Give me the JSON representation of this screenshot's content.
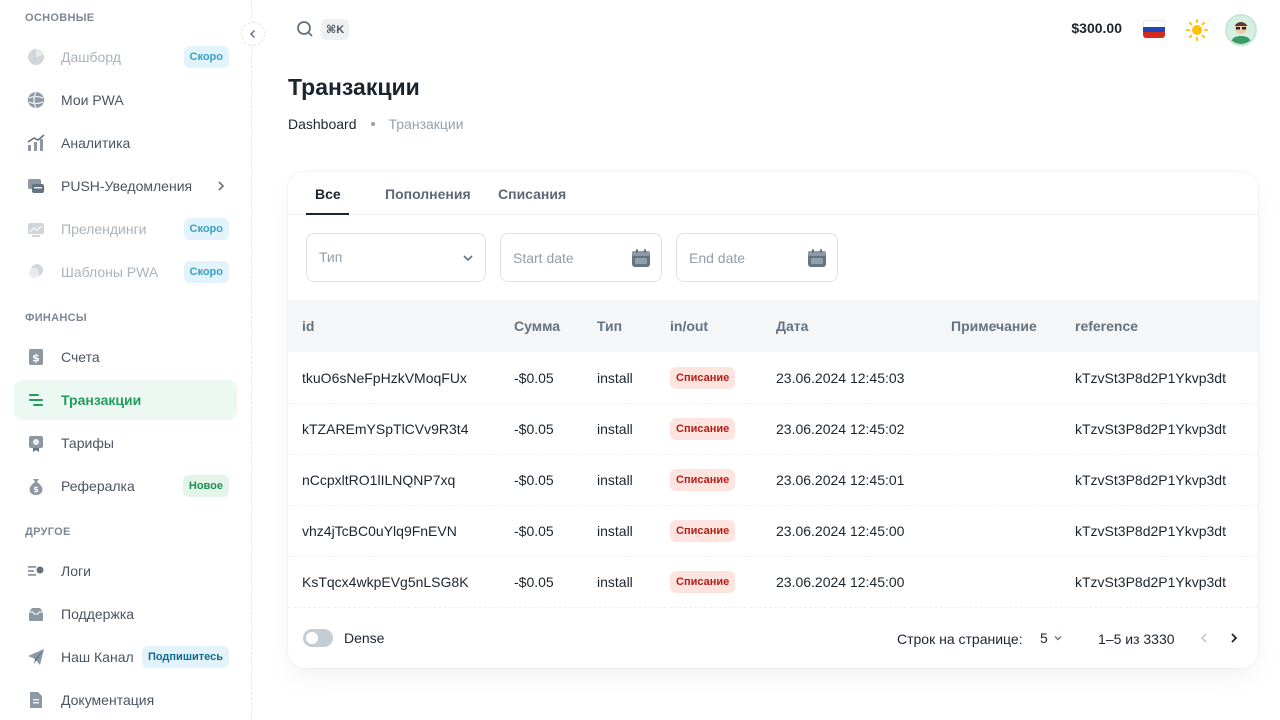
{
  "sidebar": {
    "sections": {
      "main": "ОСНОВНЫЕ",
      "finance": "ФИНАНСЫ",
      "other": "ДРУГОЕ"
    },
    "items": [
      {
        "label": "Дашборд",
        "badge": "Скоро",
        "icon": "dashboard-icon"
      },
      {
        "label": "Мои PWA",
        "icon": "globe-icon"
      },
      {
        "label": "Аналитика",
        "icon": "analytics-icon"
      },
      {
        "label": "PUSH-Уведомления",
        "icon": "push-icon"
      },
      {
        "label": "Прелендинги",
        "badge": "Скоро",
        "icon": "prelanding-icon"
      },
      {
        "label": "Шаблоны PWA",
        "badge": "Скоро",
        "icon": "templates-icon"
      },
      {
        "label": "Счета",
        "icon": "invoice-icon"
      },
      {
        "label": "Транзакции",
        "icon": "transactions-icon"
      },
      {
        "label": "Тарифы",
        "icon": "tariffs-icon"
      },
      {
        "label": "Рефералка",
        "badge": "Новое",
        "icon": "referral-icon"
      },
      {
        "label": "Логи",
        "icon": "logs-icon"
      },
      {
        "label": "Поддержка",
        "icon": "support-icon"
      },
      {
        "label": "Наш Канал",
        "badge": "Подпишитесь",
        "icon": "telegram-icon"
      },
      {
        "label": "Документация",
        "icon": "docs-icon"
      }
    ]
  },
  "header": {
    "shortcut": "⌘K",
    "balance": "$300.00",
    "language_flag": "russian-flag-icon"
  },
  "page": {
    "title": "Транзакции",
    "breadcrumb": {
      "root": "Dashboard",
      "current": "Транзакции"
    }
  },
  "tabs": [
    "Все",
    "Пополнения",
    "Списания"
  ],
  "filters": {
    "type_placeholder": "Тип",
    "start_placeholder": "Start date",
    "end_placeholder": "End date"
  },
  "table": {
    "columns": [
      "id",
      "Сумма",
      "Тип",
      "in/out",
      "Дата",
      "Примечание",
      "reference"
    ],
    "rows": [
      {
        "id": "tkuO6sNeFpHzkVMoqFUx",
        "amount": "-$0.05",
        "type": "install",
        "inout": "Списание",
        "date": "23.06.2024 12:45:03",
        "note": "",
        "reference": "kTzvSt3P8d2P1Ykvp3dt"
      },
      {
        "id": "kTZAREmYSpTlCVv9R3t4",
        "amount": "-$0.05",
        "type": "install",
        "inout": "Списание",
        "date": "23.06.2024 12:45:02",
        "note": "",
        "reference": "kTzvSt3P8d2P1Ykvp3dt"
      },
      {
        "id": "nCcpxltRO1lILNQNP7xq",
        "amount": "-$0.05",
        "type": "install",
        "inout": "Списание",
        "date": "23.06.2024 12:45:01",
        "note": "",
        "reference": "kTzvSt3P8d2P1Ykvp3dt"
      },
      {
        "id": "vhz4jTcBC0uYlq9FnEVN",
        "amount": "-$0.05",
        "type": "install",
        "inout": "Списание",
        "date": "23.06.2024 12:45:00",
        "note": "",
        "reference": "kTzvSt3P8d2P1Ykvp3dt"
      },
      {
        "id": "KsTqcx4wkpEVg5nLSG8K",
        "amount": "-$0.05",
        "type": "install",
        "inout": "Списание",
        "date": "23.06.2024 12:45:00",
        "note": "",
        "reference": "kTzvSt3P8d2P1Ykvp3dt"
      }
    ]
  },
  "footer": {
    "dense_label": "Dense",
    "rows_per_page_label": "Строк на странице:",
    "rows_per_page": "5",
    "range": "1–5 из 3330"
  },
  "colors": {
    "accent": "#1f9d5c",
    "chip_bg": "#fde4df",
    "chip_text": "#b71d18"
  }
}
